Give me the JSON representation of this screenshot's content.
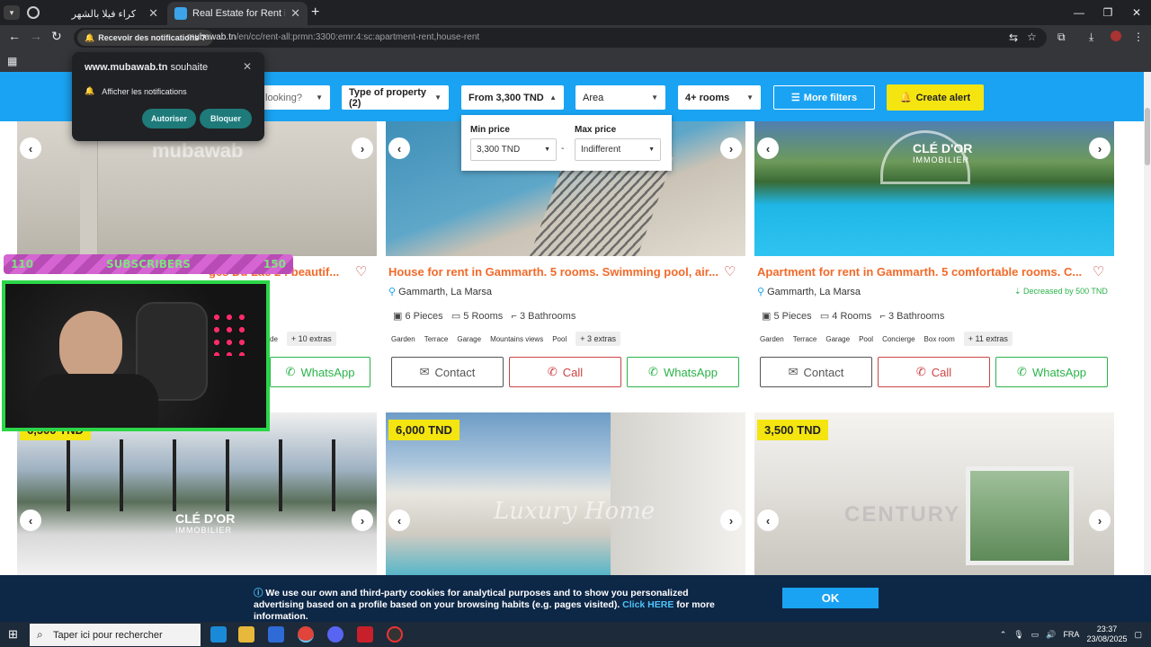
{
  "browser": {
    "tabs": [
      {
        "title": "كراء فيلا بالشهر",
        "active": false
      },
      {
        "title": "Real Estate for Rent in Tunisia, F",
        "active": true
      }
    ],
    "notification_chip": "Recevoir des notifications ?",
    "url_host": "mubawab.tn",
    "url_path": "/en/cc/rent-all:prmn:3300:emr:4:sc:apartment-rent,house-rent"
  },
  "notification_popup": {
    "site": "www.mubawab.tn",
    "verb": "souhaite",
    "line": "Afficher les notifications",
    "allow": "Autoriser",
    "block": "Bloquer"
  },
  "filters": {
    "looking": "looking?",
    "property": "Type of property (2)",
    "price": "From 3,300 TND",
    "area": "Area",
    "rooms": "4+ rooms",
    "more": "More filters",
    "alert": "Create alert"
  },
  "price_dropdown": {
    "min_label": "Min price",
    "min_value": "3,300 TND",
    "max_label": "Max price",
    "max_value": "Indifferent",
    "dash": "-"
  },
  "listings": [
    {
      "title_partial": "ges Du Lac 2 : beautif...",
      "amen_partial": "de",
      "extras": "+ 10 extras",
      "whatsapp": "WhatsApp",
      "watermark": "mubawab"
    },
    {
      "title": "House for rent in Gammarth. 5 rooms. Swimming pool, air...",
      "location": "Gammarth, La Marsa",
      "pieces": "6 Pieces",
      "rooms": "5 Rooms",
      "bathrooms": "3 Bathrooms",
      "amenities": [
        "Garden",
        "Terrace",
        "Garage",
        "Mountains views",
        "Pool"
      ],
      "extras": "+ 3 extras",
      "contact": "Contact",
      "call": "Call",
      "whatsapp": "WhatsApp"
    },
    {
      "title": "Apartment for rent in Gammarth. 5 comfortable rooms. C...",
      "location": "Gammarth, La Marsa",
      "decrease": "Decreased by 500 TND",
      "pieces": "5 Pieces",
      "rooms": "4 Rooms",
      "bathrooms": "3 Bathrooms",
      "amenities": [
        "Garden",
        "Terrace",
        "Garage",
        "Pool",
        "Concierge",
        "Box room"
      ],
      "extras": "+ 11 extras",
      "contact": "Contact",
      "call": "Call",
      "whatsapp": "WhatsApp",
      "watermark_brand": "CLÉ D'OR",
      "watermark_sub": "IMMOBILIER"
    }
  ],
  "row2": [
    {
      "price_partial": "6,500 TND",
      "watermark_brand": "CLÉ D'OR",
      "watermark_sub": "IMMOBILIER"
    },
    {
      "price": "6,000 TND",
      "watermark": "Luxury Home"
    },
    {
      "price": "3,500 TND",
      "watermark": "CENTURY"
    }
  ],
  "overlay": {
    "sub_left": "110",
    "sub_label": "SUBSCRIBERS",
    "sub_right": "150"
  },
  "cookie": {
    "text1": "We use our own and third-party cookies for analytical purposes and to show you personalized advertising based on a profile based on your browsing habits (e.g. pages visited).",
    "link": "Click HERE",
    "text2": "for more information.",
    "ok": "OK"
  },
  "taskbar": {
    "search": "Taper ici pour rechercher",
    "lang": "FRA",
    "time": "23:37",
    "date": "23/08/2025"
  },
  "colors": {
    "accent": "#1aa3f2",
    "title_orange": "#f26a2a",
    "whatsapp_green": "#2bb34a",
    "price_yellow": "#f4e510"
  }
}
